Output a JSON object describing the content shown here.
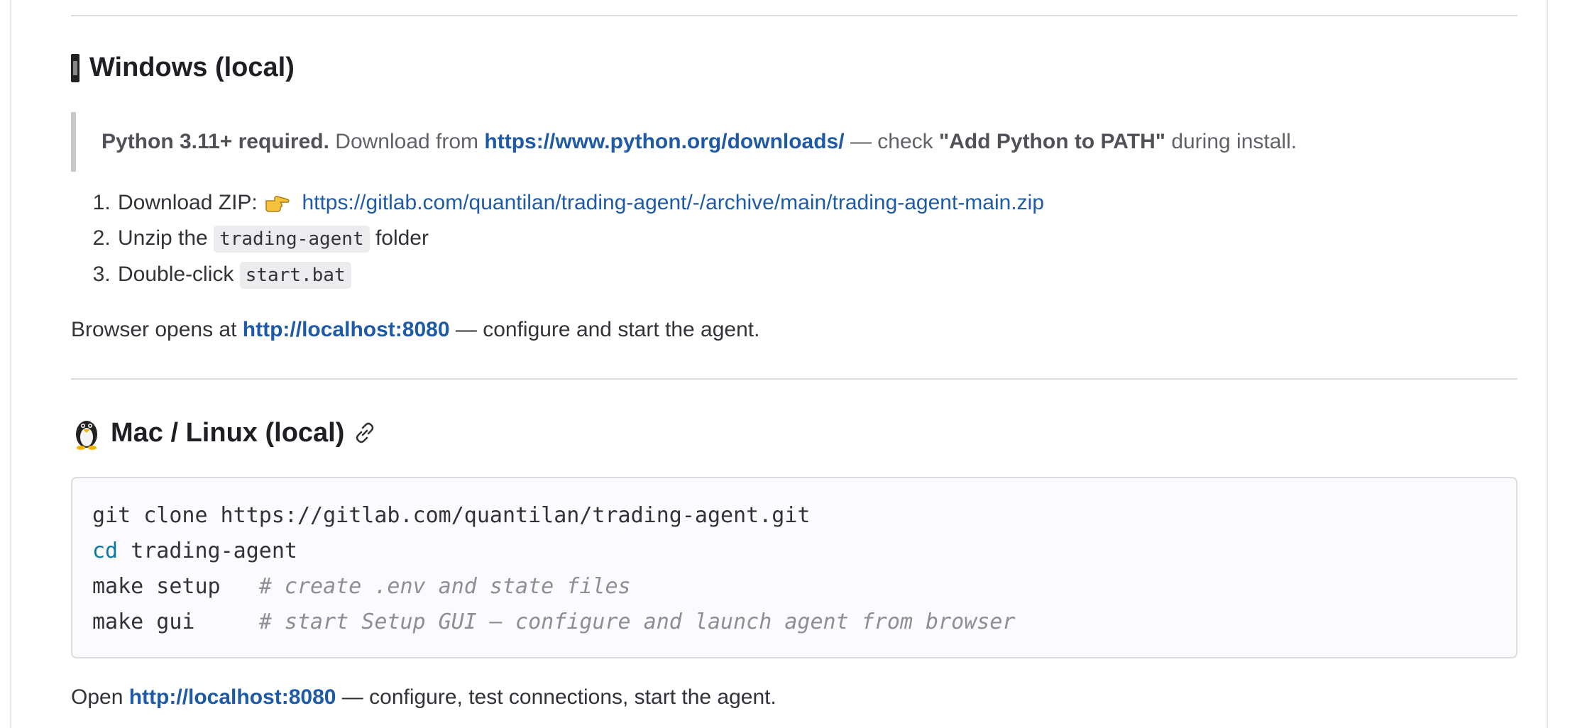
{
  "windows": {
    "title": "Windows (local)",
    "icon": "windows-flag-icon",
    "note": {
      "strong": "Python 3.11+ required.",
      "text1": "Download from",
      "link": "https://www.python.org/downloads/",
      "text2": "— check",
      "strong2": "\"Add Python to PATH\"",
      "text3": "during install."
    },
    "steps": [
      {
        "text": "Download ZIP:",
        "icon": "pointing-hand-icon",
        "link": "https://gitlab.com/quantilan/trading-agent/-/archive/main/trading-agent-main.zip"
      },
      {
        "text": "Unzip the",
        "code": "trading-agent",
        "tail": "folder"
      },
      {
        "text": "Double-click",
        "code": "start.bat"
      }
    ],
    "after": {
      "text1": "Browser opens at",
      "link": "http://localhost:8080",
      "text2": "— configure and start the agent."
    }
  },
  "mac": {
    "title": "Mac / Linux (local)",
    "icon": "penguin-icon",
    "anchor_icon": "link-icon",
    "code": [
      {
        "cmd": "git clone https://gitlab.com/quantilan/trading-agent.git"
      },
      {
        "kw": "cd",
        "cmd": "trading-agent"
      },
      {
        "cmd": "make setup",
        "comment": "# create .env and state files"
      },
      {
        "cmd": "make gui",
        "comment": "# start Setup GUI — configure and launch agent from browser"
      }
    ],
    "after": {
      "text1": "Open",
      "link": "http://localhost:8080",
      "text2": "— configure, test connections, start the agent."
    }
  },
  "colors": {
    "link": "#1f5aa6",
    "code_keyword": "#0a7aa3",
    "comment": "#8f8e93"
  }
}
